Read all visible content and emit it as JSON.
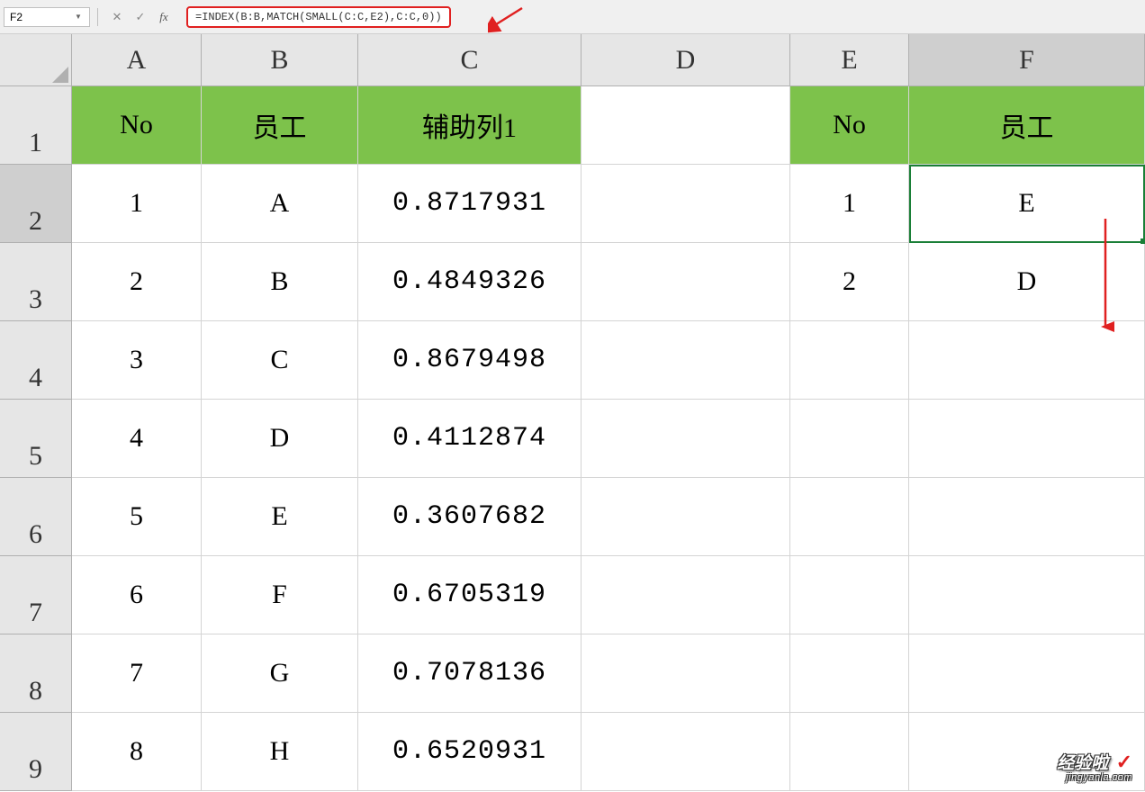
{
  "nameBox": "F2",
  "formula": "=INDEX(B:B,MATCH(SMALL(C:C,E2),C:C,0))",
  "fbButtons": {
    "cancel": "✕",
    "confirm": "✓",
    "fx": "fx"
  },
  "colHeaders": [
    "A",
    "B",
    "C",
    "D",
    "E",
    "F"
  ],
  "rowHeaders": [
    "1",
    "2",
    "3",
    "4",
    "5",
    "6",
    "7",
    "8",
    "9"
  ],
  "table1": {
    "headers": {
      "no": "No",
      "emp": "员工",
      "aux": "辅助列1"
    },
    "rows": [
      {
        "no": "1",
        "emp": "A",
        "aux": "0.8717931"
      },
      {
        "no": "2",
        "emp": "B",
        "aux": "0.4849326"
      },
      {
        "no": "3",
        "emp": "C",
        "aux": "0.8679498"
      },
      {
        "no": "4",
        "emp": "D",
        "aux": "0.4112874"
      },
      {
        "no": "5",
        "emp": "E",
        "aux": "0.3607682"
      },
      {
        "no": "6",
        "emp": "F",
        "aux": "0.6705319"
      },
      {
        "no": "7",
        "emp": "G",
        "aux": "0.7078136"
      },
      {
        "no": "8",
        "emp": "H",
        "aux": "0.6520931"
      }
    ]
  },
  "table2": {
    "headers": {
      "no": "No",
      "emp": "员工"
    },
    "rows": [
      {
        "no": "1",
        "emp": "E"
      },
      {
        "no": "2",
        "emp": "D"
      }
    ]
  },
  "watermark": {
    "main": "经验啦",
    "check": "✓",
    "sub": "jingyanla.com"
  }
}
